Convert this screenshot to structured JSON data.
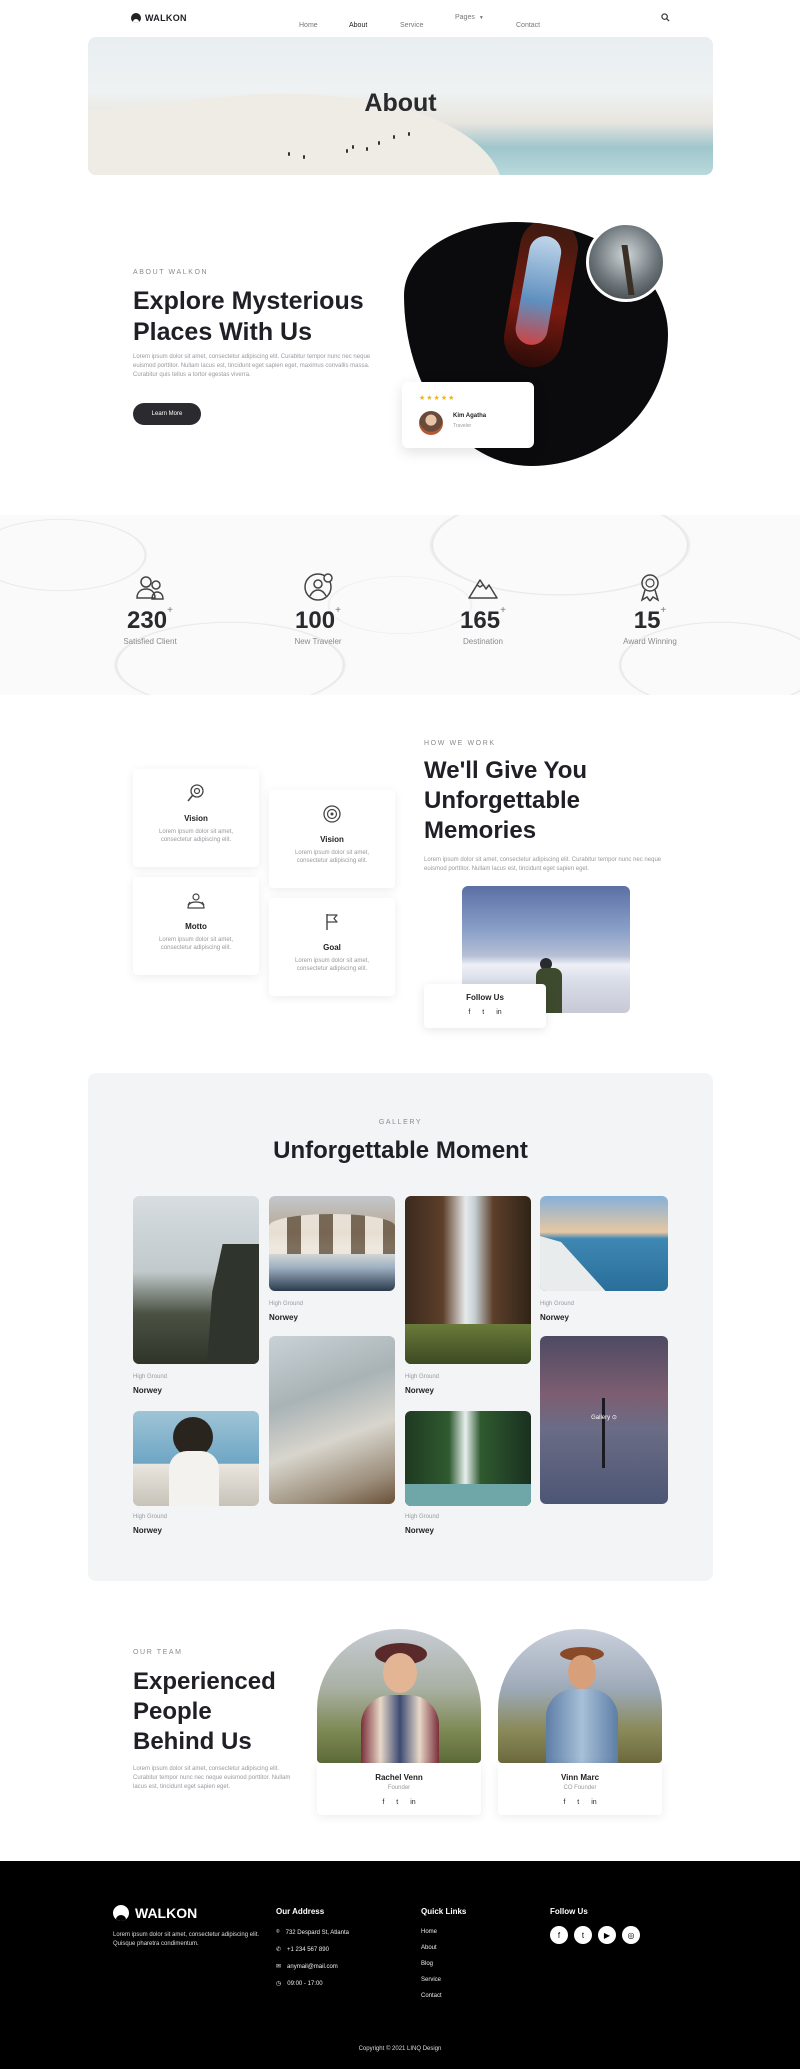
{
  "nav": {
    "brand": "WALKON",
    "links": [
      "Home",
      "About",
      "Service",
      "Pages",
      "Contact"
    ],
    "active": "About"
  },
  "hero": {
    "title": "About"
  },
  "about": {
    "eyebrow": "ABOUT WALKON",
    "title_line1": "Explore Mysterious",
    "title_line2": "Places With Us",
    "body": "Lorem ipsum dolor sit amet, consectetur adipiscing elit. Curabitur tempor nunc nec neque euismod porttitor. Nullam lacus est, tincidunt eget sapien eget, maximus convallis massa. Curabitur quis tellus a tortor egestas viverra.",
    "button": "Learn More",
    "review": {
      "stars": "★★★★★",
      "name": "Kim Agatha",
      "role": "Traveler"
    }
  },
  "stats": [
    {
      "value": "230",
      "suffix": "+",
      "label": "Satisfied Client",
      "icon": "clients-icon"
    },
    {
      "value": "100",
      "suffix": "+",
      "label": "New Traveler",
      "icon": "traveler-icon"
    },
    {
      "value": "165",
      "suffix": "+",
      "label": "Destination",
      "icon": "mountain-icon"
    },
    {
      "value": "15",
      "suffix": "+",
      "label": "Award Winning",
      "icon": "award-icon"
    }
  ],
  "how": {
    "eyebrow": "HOW WE WORK",
    "title_line1": "We'll Give You",
    "title_line2": "Unforgettable",
    "title_line3": "Memories",
    "body": "Lorem ipsum dolor sit amet, consectetur adipiscing elit. Curabitur tempor nunc nec neque euismod porttitor. Nullam lacus est, tincidunt eget sapien eget.",
    "cards": [
      {
        "title": "Vision",
        "text": "Lorem ipsum dolor sit amet, consectetur adipiscing elit.",
        "icon": "vision-icon"
      },
      {
        "title": "Vision",
        "text": "Lorem ipsum dolor sit amet, consectetur adipiscing elit.",
        "icon": "target-icon"
      },
      {
        "title": "Motto",
        "text": "Lorem ipsum dolor sit amet, consectetur adipiscing elit.",
        "icon": "motto-icon"
      },
      {
        "title": "Goal",
        "text": "Lorem ipsum dolor sit amet, consectetur adipiscing elit.",
        "icon": "flag-icon"
      }
    ],
    "follow_title": "Follow Us",
    "social": [
      "f",
      "t",
      "in"
    ]
  },
  "gallery": {
    "eyebrow": "GALLERY",
    "title": "Unforgettable Moment",
    "items": [
      {
        "sub": "High Ground",
        "title": "Norwey"
      },
      {
        "sub": "High Ground",
        "title": "Norwey"
      },
      {
        "sub": "High Ground",
        "title": "Norwey"
      },
      {
        "sub": "High Ground",
        "title": "Norwey"
      },
      {
        "sub": "High Ground",
        "title": "Norwey"
      },
      {
        "sub": "High Ground",
        "title": "Norwey"
      },
      {
        "sub": "High Ground",
        "title": "Norwey"
      }
    ],
    "overlay_label": "Gallery"
  },
  "team": {
    "eyebrow": "OUR TEAM",
    "title_line1": "Experienced",
    "title_line2": "People",
    "title_line3": "Behind Us",
    "body": "Lorem ipsum dolor sit amet, consectetur adipiscing elit. Curabitur tempor nunc nec neque euismod porttitor. Nullam lacus est, tincidunt eget sapien eget.",
    "members": [
      {
        "name": "Rachel Venn",
        "role": "Founder",
        "social": [
          "f",
          "t",
          "in"
        ]
      },
      {
        "name": "Vinn Marc",
        "role": "CO Founder",
        "social": [
          "f",
          "t",
          "in"
        ]
      }
    ]
  },
  "footer": {
    "brand": "WALKON",
    "tagline": "Lorem ipsum dolor sit amet, consectetur adipiscing elit. Quisque pharetra condimentum.",
    "address_title": "Our Address",
    "address": [
      "732 Despard St, Atlanta",
      "+1 234 567 890",
      "anymail@mail.com",
      "09:00 - 17:00"
    ],
    "links_title": "Quick Links",
    "links": [
      "Home",
      "About",
      "Blog",
      "Service",
      "Contact"
    ],
    "follow_title": "Follow Us",
    "social": [
      "f",
      "t",
      "▶",
      "◎"
    ],
    "copyright": "Copyright © 2021 LINQ Design"
  },
  "colors": {
    "dark": "#2b2b2f",
    "star": "#f2b705",
    "gallery_bg": "#f2f4f6",
    "footer_bg": "#000000"
  }
}
